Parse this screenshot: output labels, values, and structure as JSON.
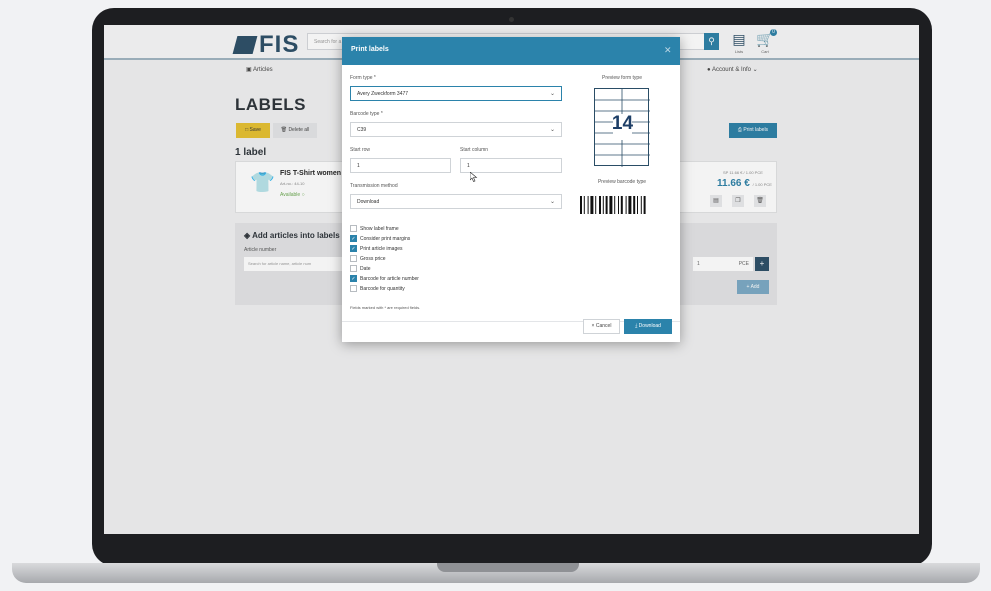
{
  "header": {
    "logo": "FIS",
    "search_placeholder": "Search for a",
    "search_icon": "search-icon",
    "lists_label": "Lists",
    "cart_label": "Cart",
    "cart_count": "0"
  },
  "subnav": {
    "articles": "Articles",
    "account": "Account & Info"
  },
  "page": {
    "title": "LABELS",
    "save": "Save",
    "delete_all": "Delete all",
    "print_labels": "Print labels",
    "count": "1 label"
  },
  "article": {
    "name": "FIS T-Shirt women",
    "number": "Art-no.: 44-10",
    "status": "Available",
    "old_price": "SP 11.66 € / 1.00 PCE",
    "price": "11.66 €",
    "price_unit": "/ 1.00 PCE"
  },
  "add_panel": {
    "title": "Add articles into labels",
    "article_number_label": "Article number",
    "search_placeholder": "Search for article name, article num",
    "qty": "1",
    "unit": "PCE",
    "add": "Add"
  },
  "modal": {
    "title": "Print labels",
    "form_type_label": "Form type *",
    "form_type_value": "Avery Zweckform 3477",
    "barcode_type_label": "Barcode type *",
    "barcode_type_value": "C39",
    "start_row_label": "Start row",
    "start_row_value": "1",
    "start_column_label": "Start column",
    "start_column_value": "1",
    "transmission_label": "Transmission method",
    "transmission_value": "Download",
    "preview_form_label": "Preview form type",
    "preview_form_number": "14",
    "preview_barcode_label": "Preview barcode type",
    "options": [
      {
        "label": "Show label frame",
        "checked": false
      },
      {
        "label": "Consider print margins",
        "checked": true
      },
      {
        "label": "Print article images",
        "checked": true
      },
      {
        "label": "Gross price",
        "checked": false
      },
      {
        "label": "Date",
        "checked": false
      },
      {
        "label": "Barcode for article number",
        "checked": true
      },
      {
        "label": "Barcode for quantity",
        "checked": false
      }
    ],
    "required_note": "Fields marked with * are required fields.",
    "cancel": "Cancel",
    "download": "Download"
  },
  "colors": {
    "accent": "#2b83ab",
    "brand": "#2a4d66",
    "save_button": "#e6c02f"
  }
}
